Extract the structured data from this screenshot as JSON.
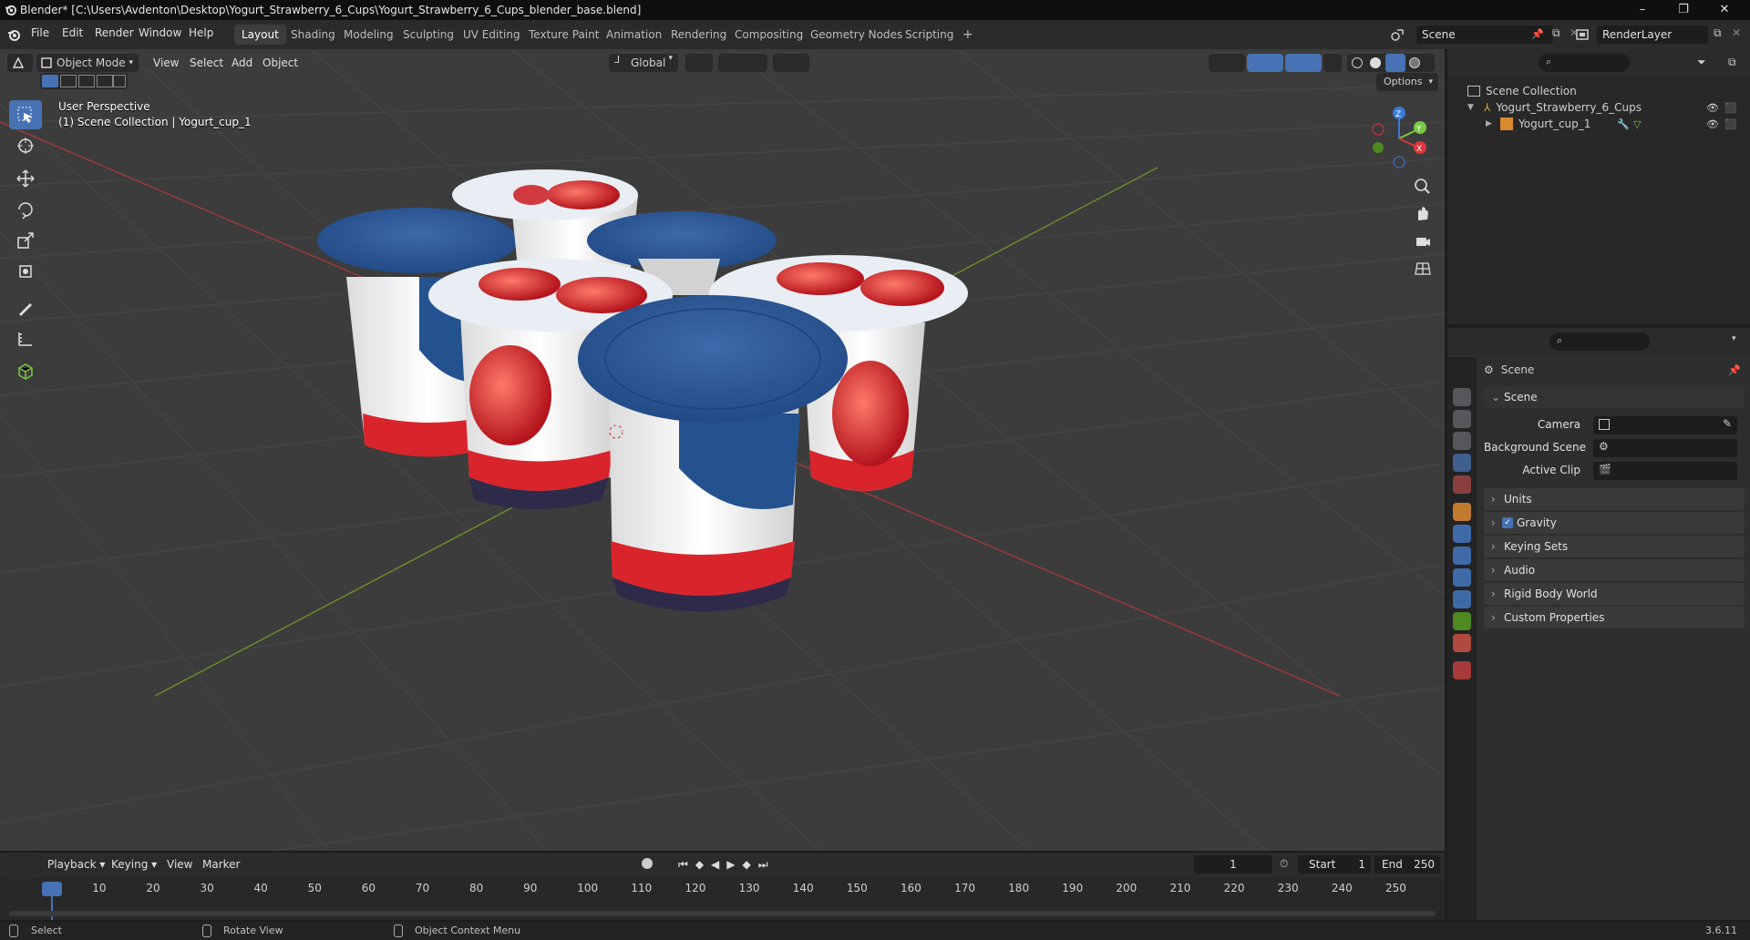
{
  "window": {
    "title": "Blender* [C:\\Users\\Avdenton\\Desktop\\Yogurt_Strawberry_6_Cups\\Yogurt_Strawberry_6_Cups_blender_base.blend]",
    "controls": [
      "–",
      "❐",
      "✕"
    ]
  },
  "menu": [
    "File",
    "Edit",
    "Render",
    "Window",
    "Help"
  ],
  "workspaces": [
    {
      "label": "Layout",
      "active": true
    },
    {
      "label": "Shading"
    },
    {
      "label": "Modeling"
    },
    {
      "label": "Sculpting"
    },
    {
      "label": "UV Editing"
    },
    {
      "label": "Texture Paint"
    },
    {
      "label": "Animation"
    },
    {
      "label": "Rendering"
    },
    {
      "label": "Compositing"
    },
    {
      "label": "Geometry Nodes"
    },
    {
      "label": "Scripting"
    }
  ],
  "add_workspace": "+",
  "scene_selector": "Scene",
  "view_layer": "RenderLayer",
  "viewport_header": {
    "mode": "Object Mode",
    "menus": [
      "View",
      "Select",
      "Add",
      "Object"
    ],
    "orientation": "Global",
    "options": "Options"
  },
  "viewport_overlay": {
    "perspective": "User Perspective",
    "collection": "(1) Scene Collection | Yogurt_cup_1"
  },
  "gizmo": {
    "x": "X",
    "y": "Y",
    "z": "Z"
  },
  "outliner": {
    "root": "Scene Collection",
    "items": [
      {
        "label": "Yogurt_Strawberry_6_Cups",
        "level": 1
      },
      {
        "label": "Yogurt_cup_1",
        "level": 2
      }
    ]
  },
  "properties": {
    "header": "Scene",
    "section": "Scene",
    "fields": [
      {
        "label": "Camera"
      },
      {
        "label": "Background Scene"
      },
      {
        "label": "Active Clip"
      }
    ],
    "panels": [
      "Units",
      "Gravity",
      "Keying Sets",
      "Audio",
      "Rigid Body World",
      "Custom Properties"
    ],
    "gravity_checked": true
  },
  "timeline": {
    "menus": [
      "Playback",
      "Keying",
      "View",
      "Marker"
    ],
    "current_frame": "1",
    "start_label": "Start",
    "start": "1",
    "end_label": "End",
    "end": "250",
    "ruler": [
      "1",
      "10",
      "20",
      "30",
      "40",
      "50",
      "60",
      "70",
      "80",
      "90",
      "100",
      "110",
      "120",
      "130",
      "140",
      "150",
      "160",
      "170",
      "180",
      "190",
      "200",
      "210",
      "220",
      "230",
      "240",
      "250"
    ]
  },
  "statusbar": {
    "select": "Select",
    "rotate": "Rotate View",
    "context": "Object Context Menu",
    "version": "3.6.11"
  }
}
